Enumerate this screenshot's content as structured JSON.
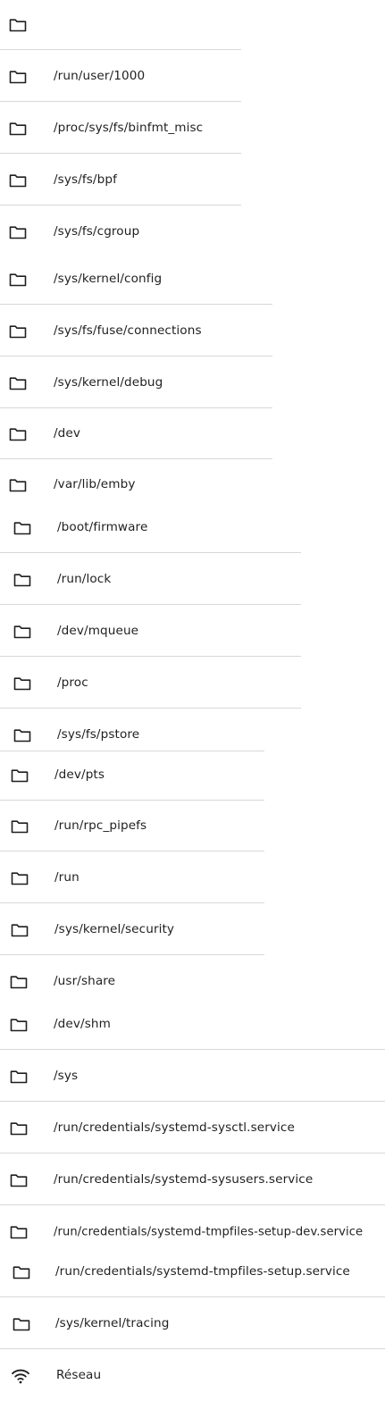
{
  "mounts_list": {
    "items": [
      {
        "label": "",
        "icon": "folder-icon"
      },
      {
        "label": "/run/user/1000",
        "icon": "folder-icon"
      },
      {
        "label": "/proc/sys/fs/binfmt_misc",
        "icon": "folder-icon"
      },
      {
        "label": "/sys/fs/bpf",
        "icon": "folder-icon"
      },
      {
        "label": "/sys/fs/cgroup",
        "icon": "folder-icon"
      },
      {
        "label": "/sys/kernel/config",
        "icon": "folder-icon"
      },
      {
        "label": "/sys/fs/fuse/connections",
        "icon": "folder-icon"
      },
      {
        "label": "/sys/kernel/debug",
        "icon": "folder-icon"
      },
      {
        "label": "/dev",
        "icon": "folder-icon"
      },
      {
        "label": "/var/lib/emby",
        "icon": "folder-icon"
      },
      {
        "label": "/boot/firmware",
        "icon": "folder-icon"
      },
      {
        "label": "/run/lock",
        "icon": "folder-icon"
      },
      {
        "label": "/dev/mqueue",
        "icon": "folder-icon"
      },
      {
        "label": "/proc",
        "icon": "folder-icon"
      },
      {
        "label": "/sys/fs/pstore",
        "icon": "folder-icon"
      },
      {
        "label": "/dev/pts",
        "icon": "folder-icon"
      },
      {
        "label": "/run/rpc_pipefs",
        "icon": "folder-icon"
      },
      {
        "label": "/run",
        "icon": "folder-icon"
      },
      {
        "label": "/sys/kernel/security",
        "icon": "folder-icon"
      },
      {
        "label": "/usr/share",
        "icon": "folder-icon"
      },
      {
        "label": "/dev/shm",
        "icon": "folder-icon"
      },
      {
        "label": "/sys",
        "icon": "folder-icon"
      },
      {
        "label": "/run/credentials/systemd-sysctl.service",
        "icon": "folder-icon"
      },
      {
        "label": "/run/credentials/systemd-sysusers.service",
        "icon": "folder-icon"
      },
      {
        "label": "/run/credentials/systemd-tmpfiles-setup-dev.service",
        "icon": "folder-icon"
      },
      {
        "label": "/run/credentials/systemd-tmpfiles-setup.service",
        "icon": "folder-icon"
      },
      {
        "label": "/sys/kernel/tracing",
        "icon": "folder-icon"
      },
      {
        "label": "Réseau",
        "icon": "wifi-icon"
      }
    ]
  },
  "colors": {
    "text": "#1f1f1f",
    "divider": "#d8d8d8",
    "icon": "#1f1f1f"
  }
}
